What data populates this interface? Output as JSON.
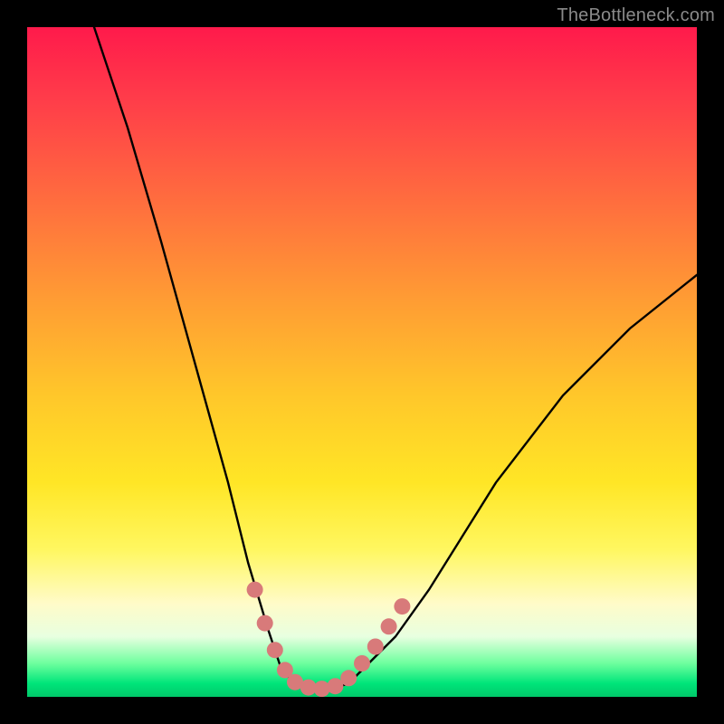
{
  "watermark": "TheBottleneck.com",
  "chart_data": {
    "type": "line",
    "title": "",
    "xlabel": "",
    "ylabel": "",
    "xlim": [
      0,
      100
    ],
    "ylim": [
      0,
      100
    ],
    "series": [
      {
        "name": "curve",
        "x": [
          10,
          15,
          20,
          25,
          30,
          33,
          36,
          38,
          40,
          42,
          45,
          48,
          50,
          55,
          60,
          65,
          70,
          80,
          90,
          100
        ],
        "y": [
          100,
          85,
          68,
          50,
          32,
          20,
          10,
          4,
          2,
          1,
          1,
          2,
          4,
          9,
          16,
          24,
          32,
          45,
          55,
          63
        ]
      }
    ],
    "markers": {
      "name": "pink-dots",
      "points": [
        {
          "x": 34.0,
          "y": 16.0
        },
        {
          "x": 35.5,
          "y": 11.0
        },
        {
          "x": 37.0,
          "y": 7.0
        },
        {
          "x": 38.5,
          "y": 4.0
        },
        {
          "x": 40.0,
          "y": 2.2
        },
        {
          "x": 42.0,
          "y": 1.4
        },
        {
          "x": 44.0,
          "y": 1.2
        },
        {
          "x": 46.0,
          "y": 1.6
        },
        {
          "x": 48.0,
          "y": 2.8
        },
        {
          "x": 50.0,
          "y": 5.0
        },
        {
          "x": 52.0,
          "y": 7.5
        },
        {
          "x": 54.0,
          "y": 10.5
        },
        {
          "x": 56.0,
          "y": 13.5
        }
      ]
    },
    "gradient_stops": [
      {
        "pos": 0.0,
        "color": "#ff1a4b"
      },
      {
        "pos": 0.4,
        "color": "#ff9a34"
      },
      {
        "pos": 0.68,
        "color": "#ffe626"
      },
      {
        "pos": 0.86,
        "color": "#fffbc8"
      },
      {
        "pos": 1.0,
        "color": "#00c869"
      }
    ]
  }
}
